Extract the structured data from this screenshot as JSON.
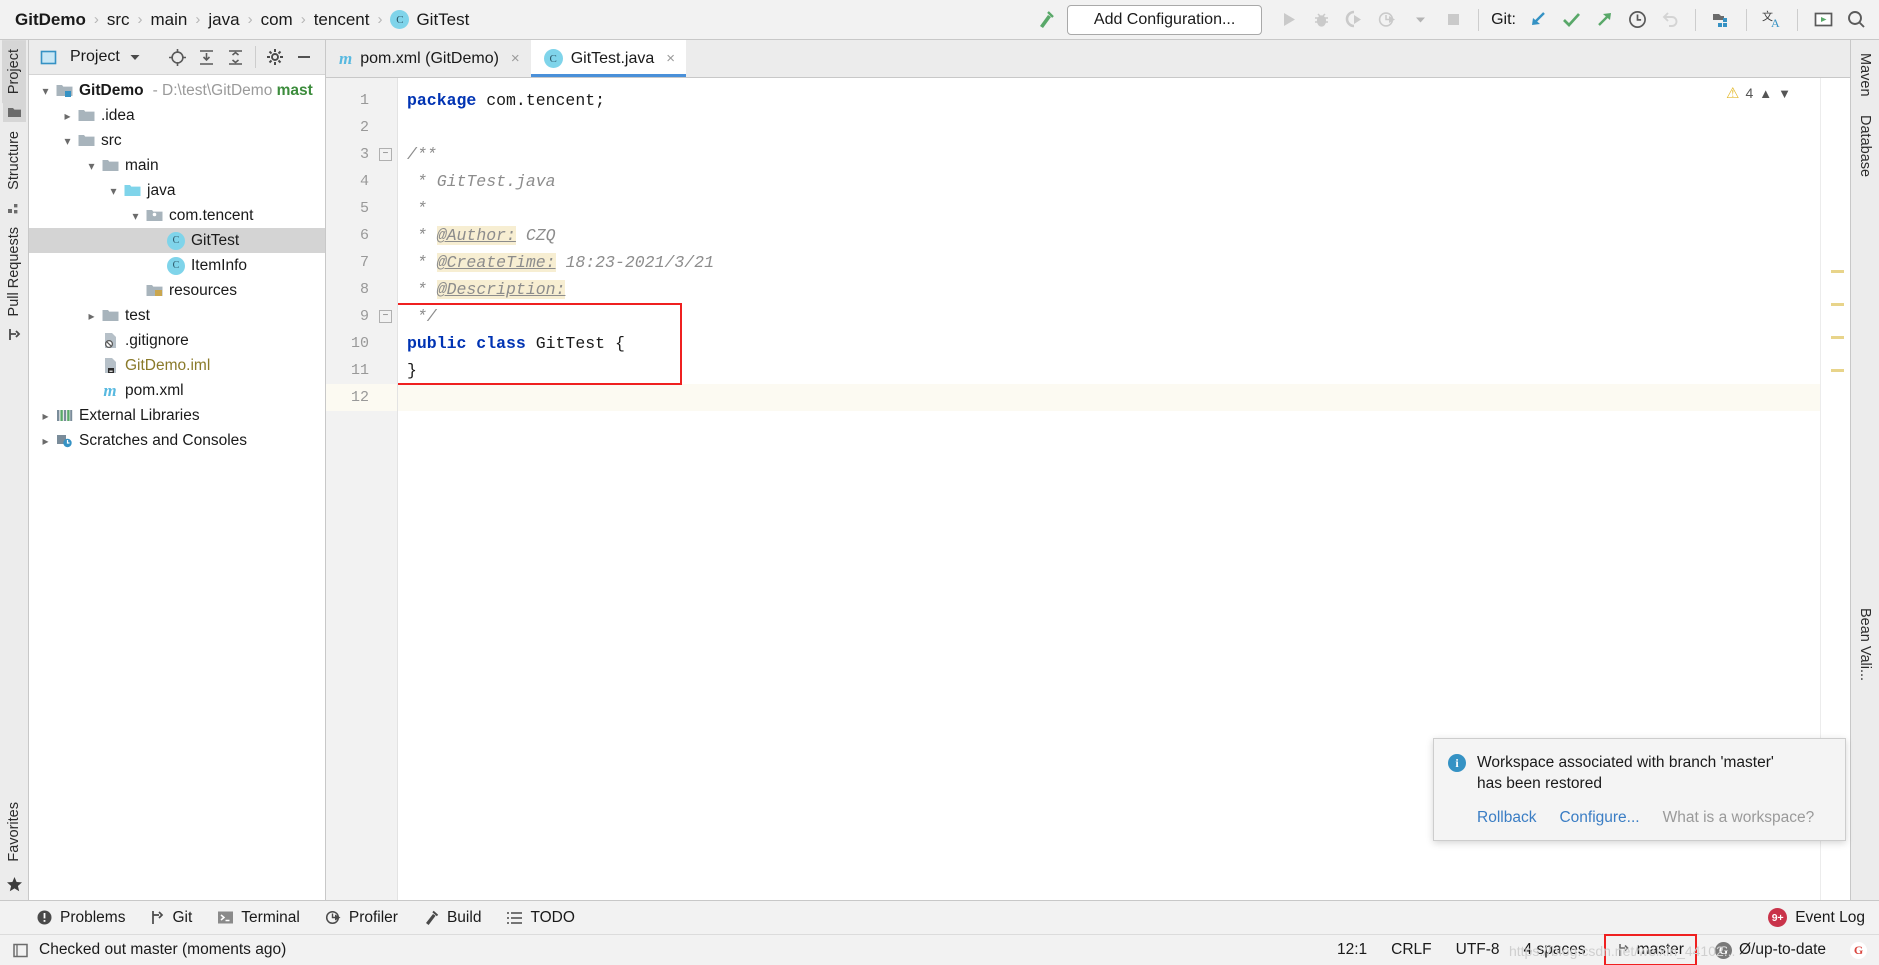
{
  "navbar": {
    "breadcrumbs": [
      {
        "label": "GitDemo",
        "icon": "",
        "root": true
      },
      {
        "label": "src",
        "icon": ""
      },
      {
        "label": "main",
        "icon": ""
      },
      {
        "label": "java",
        "icon": ""
      },
      {
        "label": "com",
        "icon": ""
      },
      {
        "label": "tencent",
        "icon": ""
      },
      {
        "label": "GitTest",
        "icon": "class-icon"
      }
    ],
    "separator": "›",
    "run_config_label": "Add Configuration...",
    "git_label": "Git:",
    "icons": [
      "build-hammer-icon",
      "run-icon",
      "debug-icon",
      "run-coverage-icon",
      "profile-icon",
      "dropdown-icon",
      "stop-icon",
      "git-update-icon",
      "git-commit-icon",
      "git-push-icon",
      "git-history-icon",
      "git-rollback-icon",
      "search-everywhere-icon",
      "translate-icon",
      "presentation-icon",
      "search-icon"
    ]
  },
  "left_stripe": {
    "tabs": [
      {
        "label": "Project",
        "selected": true,
        "icon": "project-icon"
      },
      {
        "label": "Structure",
        "selected": false,
        "icon": "structure-icon"
      },
      {
        "label": "Pull Requests",
        "selected": false,
        "icon": "pull-request-icon"
      }
    ],
    "bottom_tabs": [
      {
        "label": "Favorites",
        "icon": "star-icon"
      }
    ]
  },
  "right_stripe": {
    "tabs": [
      {
        "label": "Maven",
        "icon": "maven-icon"
      },
      {
        "label": "Database",
        "icon": "database-icon"
      },
      {
        "label": "Bean Vali...",
        "icon": "bean-icon"
      }
    ]
  },
  "project_panel": {
    "title": "Project",
    "header_icons": [
      "project-view-icon",
      "chevron-down-icon",
      "locate-icon",
      "expand-all-icon",
      "collapse-all-icon",
      "gear-icon",
      "hide-icon"
    ],
    "tree": [
      {
        "depth": 0,
        "label": "GitDemo",
        "suffix": " - D:\\test\\GitDemo ",
        "suffix_bold": "mast",
        "arrow": "down",
        "icon": "module-folder-icon",
        "bold": true,
        "selected": false
      },
      {
        "depth": 1,
        "label": ".idea",
        "arrow": "right",
        "icon": "folder-icon",
        "selected": false
      },
      {
        "depth": 1,
        "label": "src",
        "arrow": "down",
        "icon": "folder-icon",
        "selected": false
      },
      {
        "depth": 2,
        "label": "main",
        "arrow": "down",
        "icon": "folder-icon",
        "selected": false
      },
      {
        "depth": 3,
        "label": "java",
        "arrow": "down",
        "icon": "source-folder-icon",
        "selected": false
      },
      {
        "depth": 4,
        "label": "com.tencent",
        "arrow": "down",
        "icon": "package-icon",
        "selected": false
      },
      {
        "depth": 5,
        "label": "GitTest",
        "arrow": "none",
        "icon": "class-icon",
        "selected": true
      },
      {
        "depth": 5,
        "label": "ItemInfo",
        "arrow": "none",
        "icon": "class-icon",
        "selected": false
      },
      {
        "depth": 3,
        "label": "resources",
        "arrow": "none",
        "icon": "resources-folder-icon",
        "selected": false
      },
      {
        "depth": 2,
        "label": "test",
        "arrow": "right",
        "icon": "folder-icon",
        "selected": false
      },
      {
        "depth": 1,
        "label": ".gitignore",
        "arrow": "none",
        "icon": "gitignore-file-icon",
        "selected": false
      },
      {
        "depth": 1,
        "label": "GitDemo.iml",
        "arrow": "none",
        "icon": "iml-file-icon",
        "selected": false,
        "color": "iml"
      },
      {
        "depth": 1,
        "label": "pom.xml",
        "arrow": "none",
        "icon": "maven-file-icon",
        "selected": false
      },
      {
        "depth": 0,
        "label": "External Libraries",
        "arrow": "right",
        "icon": "libraries-icon",
        "selected": false
      },
      {
        "depth": 0,
        "label": "Scratches and Consoles",
        "arrow": "right",
        "icon": "scratches-icon",
        "selected": false
      }
    ]
  },
  "editor": {
    "tabs": [
      {
        "label": "pom.xml (GitDemo)",
        "icon": "maven-file-icon",
        "active": false,
        "close": "×"
      },
      {
        "label": "GitTest.java",
        "icon": "class-icon",
        "active": true,
        "close": "×"
      }
    ],
    "inspection": {
      "warning_count": "4",
      "warning_icon": "warning-triangle-icon",
      "up_icon": "chevron-up-icon",
      "down_icon": "chevron-down-icon"
    },
    "line_numbers": [
      "1",
      "2",
      "3",
      "4",
      "5",
      "6",
      "7",
      "8",
      "9",
      "10",
      "11",
      "12"
    ],
    "current_line": 12,
    "lines": [
      {
        "n": 1,
        "segments": [
          {
            "t": "package",
            "c": "kw"
          },
          {
            "t": " com.tencent;",
            "c": ""
          }
        ]
      },
      {
        "n": 2,
        "segments": [
          {
            "t": "",
            "c": ""
          }
        ]
      },
      {
        "n": 3,
        "segments": [
          {
            "t": "/**",
            "c": "cmt"
          }
        ],
        "fold": "open"
      },
      {
        "n": 4,
        "segments": [
          {
            "t": " * GitTest.java",
            "c": "cmt"
          }
        ]
      },
      {
        "n": 5,
        "segments": [
          {
            "t": " *",
            "c": "cmt"
          }
        ]
      },
      {
        "n": 6,
        "segments": [
          {
            "t": " * ",
            "c": "cmt"
          },
          {
            "t": "@Author:",
            "c": "tag"
          },
          {
            "t": " CZQ",
            "c": "cmt"
          }
        ]
      },
      {
        "n": 7,
        "segments": [
          {
            "t": " * ",
            "c": "cmt"
          },
          {
            "t": "@CreateTime:",
            "c": "tag"
          },
          {
            "t": " 18:23-2021/3/21",
            "c": "cmt"
          }
        ]
      },
      {
        "n": 8,
        "segments": [
          {
            "t": " * ",
            "c": "cmt"
          },
          {
            "t": "@Description:",
            "c": "tag"
          }
        ]
      },
      {
        "n": 9,
        "segments": [
          {
            "t": " */",
            "c": "cmt"
          }
        ],
        "fold": "close"
      },
      {
        "n": 10,
        "segments": [
          {
            "t": "public class",
            "c": "kw"
          },
          {
            "t": " GitTest {",
            "c": ""
          }
        ]
      },
      {
        "n": 11,
        "segments": [
          {
            "t": "}",
            "c": ""
          }
        ]
      },
      {
        "n": 12,
        "segments": [
          {
            "t": "",
            "c": ""
          }
        ]
      }
    ]
  },
  "notification": {
    "title_line1": "Workspace associated with branch 'master'",
    "title_line2": "has been restored",
    "icon": "info-icon",
    "icon_glyph": "i",
    "links": [
      {
        "label": "Rollback",
        "muted": false
      },
      {
        "label": "Configure...",
        "muted": false
      },
      {
        "label": "What is a workspace?",
        "muted": true
      }
    ]
  },
  "bottom_toolbar": {
    "items": [
      {
        "label": "Problems",
        "icon": "problems-icon"
      },
      {
        "label": "Git",
        "icon": "git-branch-icon"
      },
      {
        "label": "Terminal",
        "icon": "terminal-icon"
      },
      {
        "label": "Profiler",
        "icon": "profiler-icon"
      },
      {
        "label": "Build",
        "icon": "build-hammer-icon"
      },
      {
        "label": "TODO",
        "icon": "todo-icon"
      }
    ],
    "event_log": {
      "label": "Event Log",
      "badge": "9+"
    }
  },
  "statusbar": {
    "message": "Checked out master (moments ago)",
    "message_icon": "book-icon",
    "caret_position": "12:1",
    "line_separator": "CRLF",
    "encoding": "UTF-8",
    "indent": "4 spaces",
    "branch": "master",
    "branch_icon": "git-branch-icon",
    "sync_status": "Ø/up-to-date",
    "watermark": "https://blog.csdn.net/weixin_44102...",
    "google_icon": "G"
  },
  "colors": {
    "accent": "#4a90d9",
    "keyword": "#0033b3",
    "comment": "#8c8c8c",
    "tag_highlight": "#f7eed2",
    "highlight_red": "#ef2020",
    "link": "#3a7dc4",
    "selection": "#d4d4d4",
    "green": "#3c8c3c"
  }
}
